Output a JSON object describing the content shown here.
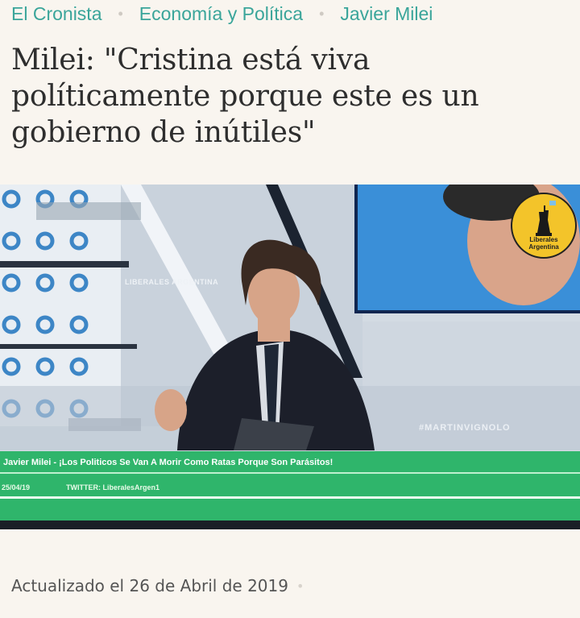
{
  "breadcrumb": {
    "items": [
      "El Cronista",
      "Economía y Política",
      "Javier Milei"
    ],
    "separator": "•"
  },
  "article": {
    "title": "Milei: \"Cristina está viva políticamente porque este es un gobierno de inútiles\"",
    "updated": "Actualizado el 26 de Abril de 2019",
    "updated_separator": "•"
  },
  "video": {
    "logo_text_1": "Liberales",
    "logo_text_2": "Argentina",
    "watermark_left": "LIBERALES ARGENTINA",
    "watermark_right": "#MARTINVIGNOLO",
    "ticker_headline": "Javier Milei - ¡Los Politicos Se Van A Morir Como Ratas Porque Son Parásitos!",
    "ticker_date": "25/04/19",
    "ticker_twitter": "TWITTER: LiberalesArgen1"
  },
  "colors": {
    "accent": "#3aa59a",
    "background": "#f9f5ef",
    "ticker_green": "#2fb56b"
  }
}
